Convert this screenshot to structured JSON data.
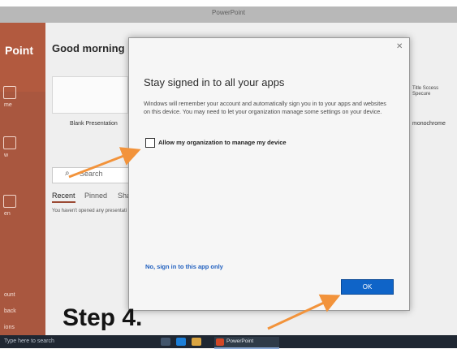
{
  "powerpoint": {
    "window_title": "PowerPoint",
    "brand": "Point",
    "greeting": "Good morning",
    "blank_presentation_label": "Blank Presentation",
    "search_placeholder": "Search",
    "tabs": [
      "Recent",
      "Pinned",
      "Shar"
    ],
    "recent_empty_text": "You haven't opened any presentati",
    "template_right_1": "Title Sccess Specure",
    "template_right_2": "monochrome",
    "rail_labels": [
      "me",
      "w",
      "en",
      "ount",
      "back",
      "ions"
    ]
  },
  "dialog": {
    "title": "Stay signed in to all your apps",
    "body": "Windows will remember your account and automatically sign you in to your apps and websites on this device. You may need to let your organization manage some settings on your device.",
    "checkbox_label": "Allow my organization to manage my device",
    "checkbox_checked": false,
    "no_link": "No, sign in to this app only",
    "ok_label": "OK"
  },
  "taskbar": {
    "search_text": "Type here to search",
    "app_label": "PowerPoint"
  },
  "annotation": {
    "step_label": "Step 4.",
    "arrow_color": "#f2933b"
  },
  "colors": {
    "accent": "#0f64c8",
    "ppt_brand": "#b25a3f"
  }
}
